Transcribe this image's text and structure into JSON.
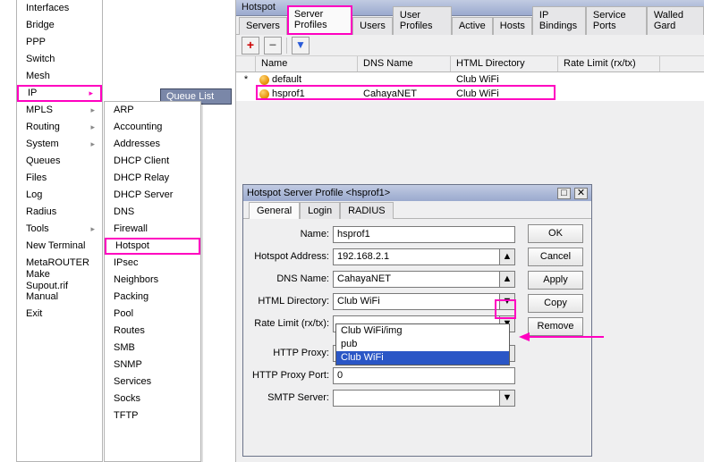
{
  "menu": [
    "Interfaces",
    "Bridge",
    "PPP",
    "Switch",
    "Mesh",
    "IP",
    "MPLS",
    "Routing",
    "System",
    "Queues",
    "Files",
    "Log",
    "Radius",
    "Tools",
    "New Terminal",
    "MetaROUTER",
    "Make Supout.rif",
    "Manual",
    "Exit"
  ],
  "menu_has_arrow": {
    "IP": true,
    "MPLS": true,
    "Routing": true,
    "System": true,
    "Tools": true
  },
  "menu_highlight": "IP",
  "submenu": [
    "ARP",
    "Accounting",
    "Addresses",
    "DHCP Client",
    "DHCP Relay",
    "DHCP Server",
    "DNS",
    "Firewall",
    "Hotspot",
    "IPsec",
    "Neighbors",
    "Packing",
    "Pool",
    "Routes",
    "SMB",
    "SNMP",
    "Services",
    "Socks",
    "TFTP"
  ],
  "submenu_highlight": "Hotspot",
  "queue_tab_label": "Queue List",
  "hotspot": {
    "title": "Hotspot",
    "tabs": [
      "Servers",
      "Server Profiles",
      "Users",
      "User Profiles",
      "Active",
      "Hosts",
      "IP Bindings",
      "Service Ports",
      "Walled Gard"
    ],
    "active_tab": "Server Profiles",
    "columns": [
      "",
      "Name",
      "DNS Name",
      "HTML Directory",
      "Rate Limit (rx/tx)"
    ],
    "rows": [
      {
        "star": "*",
        "name": "default",
        "dns": "",
        "html": "Club WiFi",
        "rate": ""
      },
      {
        "star": "",
        "name": "hsprof1",
        "dns": "CahayaNET",
        "html": "Club WiFi",
        "rate": ""
      }
    ]
  },
  "profile": {
    "title": "Hotspot Server Profile <hsprof1>",
    "tabs": [
      "General",
      "Login",
      "RADIUS"
    ],
    "active_tab": "General",
    "buttons": [
      "OK",
      "Cancel",
      "Apply",
      "Copy",
      "Remove"
    ],
    "fields": {
      "name_label": "Name:",
      "name_value": "hsprof1",
      "addr_label": "Hotspot Address:",
      "addr_value": "192.168.2.1",
      "dns_label": "DNS Name:",
      "dns_value": "CahayaNET",
      "html_label": "HTML Directory:",
      "html_value": "Club WiFi",
      "rate_label": "Rate Limit (rx/tx):",
      "rate_value": "",
      "hproxy_label": "HTTP Proxy:",
      "hproxy_value": "",
      "hport_label": "HTTP Proxy Port:",
      "hport_value": "0",
      "smtp_label": "SMTP Server:",
      "smtp_value": ""
    },
    "dropdown_options": [
      "Club WiFi/img",
      "pub",
      "Club WiFi"
    ],
    "dropdown_selected": "Club WiFi"
  }
}
